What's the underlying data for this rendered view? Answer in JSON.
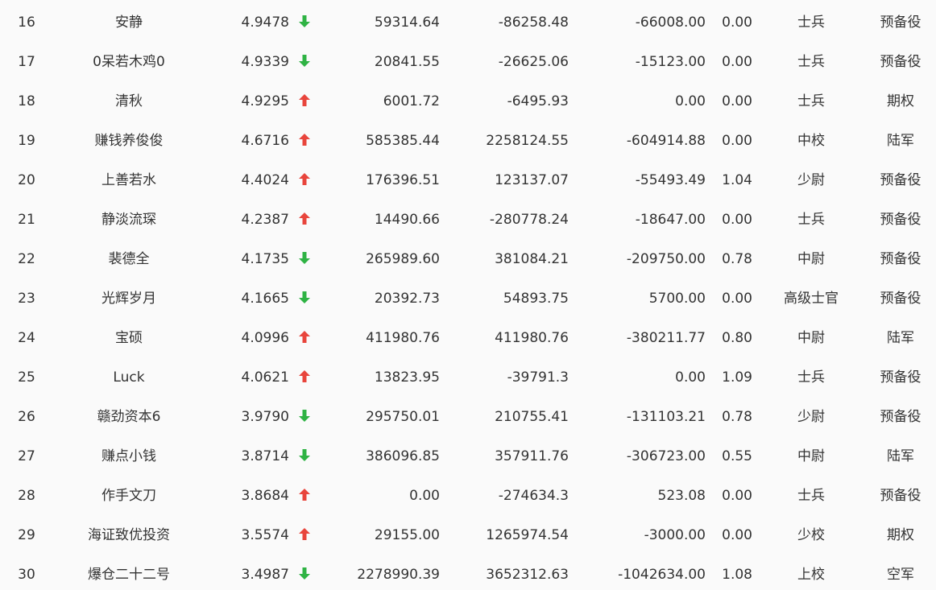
{
  "colors": {
    "up": "#e8453c",
    "down": "#2fb344",
    "text": "#333333",
    "background": "#fafafa"
  },
  "rows": [
    {
      "rank": "16",
      "name": "安静",
      "score": "4.9478",
      "trend": "down",
      "v1": "59314.64",
      "v2": "-86258.48",
      "v3": "-66008.00",
      "v4": "0.00",
      "rank_name": "士兵",
      "group": "预备役"
    },
    {
      "rank": "17",
      "name": "0呆若木鸡0",
      "score": "4.9339",
      "trend": "down",
      "v1": "20841.55",
      "v2": "-26625.06",
      "v3": "-15123.00",
      "v4": "0.00",
      "rank_name": "士兵",
      "group": "预备役"
    },
    {
      "rank": "18",
      "name": "清秋",
      "score": "4.9295",
      "trend": "up",
      "v1": "6001.72",
      "v2": "-6495.93",
      "v3": "0.00",
      "v4": "0.00",
      "rank_name": "士兵",
      "group": "期权"
    },
    {
      "rank": "19",
      "name": "赚钱养俊俊",
      "score": "4.6716",
      "trend": "up",
      "v1": "585385.44",
      "v2": "2258124.55",
      "v3": "-604914.88",
      "v4": "0.00",
      "rank_name": "中校",
      "group": "陆军"
    },
    {
      "rank": "20",
      "name": "上善若水",
      "score": "4.4024",
      "trend": "up",
      "v1": "176396.51",
      "v2": "123137.07",
      "v3": "-55493.49",
      "v4": "1.04",
      "rank_name": "少尉",
      "group": "预备役"
    },
    {
      "rank": "21",
      "name": "静淡流琛",
      "score": "4.2387",
      "trend": "up",
      "v1": "14490.66",
      "v2": "-280778.24",
      "v3": "-18647.00",
      "v4": "0.00",
      "rank_name": "士兵",
      "group": "预备役"
    },
    {
      "rank": "22",
      "name": "裴德全",
      "score": "4.1735",
      "trend": "down",
      "v1": "265989.60",
      "v2": "381084.21",
      "v3": "-209750.00",
      "v4": "0.78",
      "rank_name": "中尉",
      "group": "预备役"
    },
    {
      "rank": "23",
      "name": "光辉岁月",
      "score": "4.1665",
      "trend": "down",
      "v1": "20392.73",
      "v2": "54893.75",
      "v3": "5700.00",
      "v4": "0.00",
      "rank_name": "高级士官",
      "group": "预备役"
    },
    {
      "rank": "24",
      "name": "宝硕",
      "score": "4.0996",
      "trend": "up",
      "v1": "411980.76",
      "v2": "411980.76",
      "v3": "-380211.77",
      "v4": "0.80",
      "rank_name": "中尉",
      "group": "陆军"
    },
    {
      "rank": "25",
      "name": "Luck",
      "score": "4.0621",
      "trend": "up",
      "v1": "13823.95",
      "v2": "-39791.3",
      "v3": "0.00",
      "v4": "1.09",
      "rank_name": "士兵",
      "group": "预备役"
    },
    {
      "rank": "26",
      "name": "赣劲资本6",
      "score": "3.9790",
      "trend": "down",
      "v1": "295750.01",
      "v2": "210755.41",
      "v3": "-131103.21",
      "v4": "0.78",
      "rank_name": "少尉",
      "group": "预备役"
    },
    {
      "rank": "27",
      "name": "赚点小钱",
      "score": "3.8714",
      "trend": "down",
      "v1": "386096.85",
      "v2": "357911.76",
      "v3": "-306723.00",
      "v4": "0.55",
      "rank_name": "中尉",
      "group": "陆军"
    },
    {
      "rank": "28",
      "name": "作手文刀",
      "score": "3.8684",
      "trend": "up",
      "v1": "0.00",
      "v2": "-274634.3",
      "v3": "523.08",
      "v4": "0.00",
      "rank_name": "士兵",
      "group": "预备役"
    },
    {
      "rank": "29",
      "name": "海证致优投资",
      "score": "3.5574",
      "trend": "up",
      "v1": "29155.00",
      "v2": "1265974.54",
      "v3": "-3000.00",
      "v4": "0.00",
      "rank_name": "少校",
      "group": "期权"
    },
    {
      "rank": "30",
      "name": "爆仓二十二号",
      "score": "3.4987",
      "trend": "down",
      "v1": "2278990.39",
      "v2": "3652312.63",
      "v3": "-1042634.00",
      "v4": "1.08",
      "rank_name": "上校",
      "group": "空军"
    }
  ]
}
